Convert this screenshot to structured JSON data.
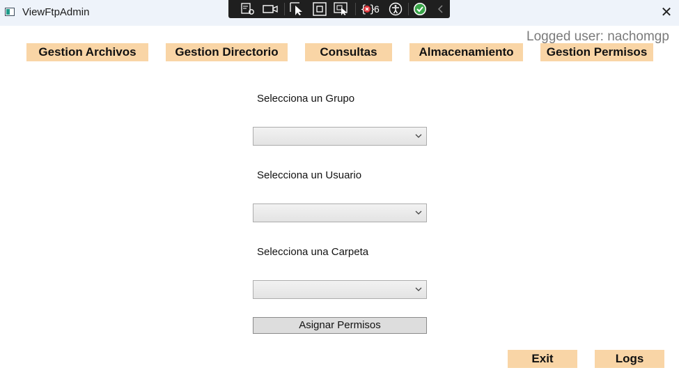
{
  "window": {
    "title": "ViewFtpAdmin",
    "close_glyph": "✕"
  },
  "debug_toolbar": {
    "tools": [
      "select-element-icon",
      "record-icon",
      "pointer-select-icon",
      "display-layout-icon",
      "track-focus-icon",
      "binding-failures-icon",
      "accessibility-icon",
      "status-ok-icon",
      "collapse-chevron-icon"
    ],
    "binding_failures_count": "6"
  },
  "header": {
    "logged_user": "Logged user: nachomgp"
  },
  "nav": {
    "gestion_archivos": "Gestion Archivos",
    "gestion_directorio": "Gestion Directorio",
    "consultas": "Consultas",
    "almacenamiento": "Almacenamiento",
    "gestion_permisos": "Gestion Permisos"
  },
  "form": {
    "grupo_label": "Selecciona un Grupo",
    "grupo_value": "",
    "usuario_label": "Selecciona un Usuario",
    "usuario_value": "",
    "carpeta_label": "Selecciona una Carpeta",
    "carpeta_value": "",
    "assign_button": "Asignar Permisos"
  },
  "footer": {
    "exit": "Exit",
    "logs": "Logs"
  },
  "colors": {
    "nav_button_bg": "#f9d5a6",
    "titlebar_bg": "#eef3fa",
    "toolbar_bg": "#1f1f1f",
    "logged_user_text": "#7a7a7a"
  }
}
